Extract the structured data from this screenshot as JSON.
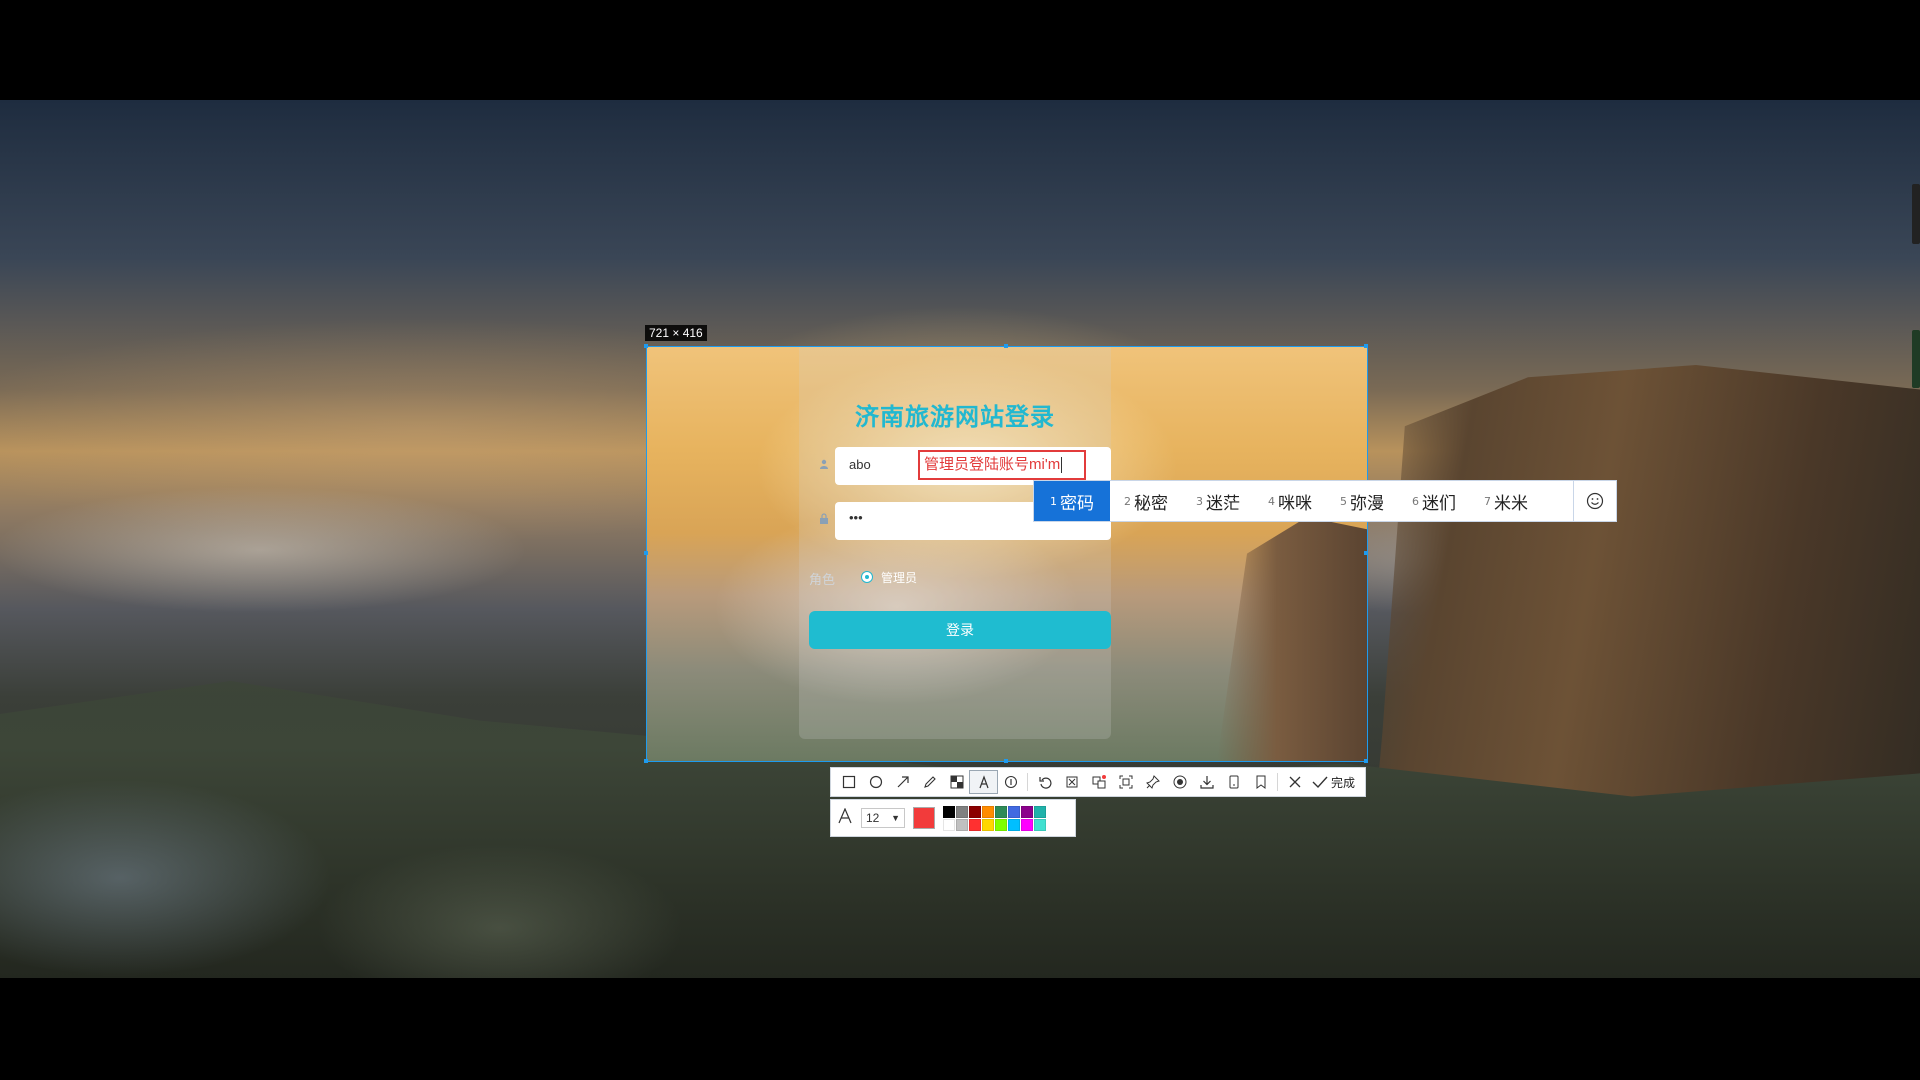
{
  "capture": {
    "dimensions_label": "721 × 416"
  },
  "login": {
    "title": "济南旅游网站登录",
    "username_value": "abo",
    "password_value": "•••",
    "role_label": "角色",
    "role_option": "管理员",
    "login_button": "登录"
  },
  "annotation": {
    "text": "管理员登陆账号mi'm"
  },
  "ime": {
    "candidates": [
      {
        "num": "1",
        "text": "密码"
      },
      {
        "num": "2",
        "text": "秘密"
      },
      {
        "num": "3",
        "text": "迷茫"
      },
      {
        "num": "4",
        "text": "咪咪"
      },
      {
        "num": "5",
        "text": "弥漫"
      },
      {
        "num": "6",
        "text": "迷们"
      },
      {
        "num": "7",
        "text": "米米"
      }
    ]
  },
  "toolbar": {
    "done_label": "完成",
    "tools": [
      "rectangle-tool",
      "ellipse-tool",
      "arrow-tool",
      "pen-tool",
      "mosaic-tool",
      "text-tool",
      "number-tool",
      "undo-tool",
      "crop-tool",
      "translate-tool",
      "ocr-tool",
      "pin-tool",
      "record-tool",
      "download-tool",
      "save-tool",
      "bookmark-tool"
    ],
    "font_size": "12",
    "current_color": "#f23b3b",
    "palette": [
      "#000000",
      "#808080",
      "#8b0000",
      "#ff8c00",
      "#2e8b57",
      "#4169e1",
      "#8b008b",
      "#20b2aa",
      "#ffffff",
      "#c0c0c0",
      "#ff3030",
      "#ffd700",
      "#7fff00",
      "#00bfff",
      "#ff00ff",
      "#40e0d0"
    ]
  }
}
